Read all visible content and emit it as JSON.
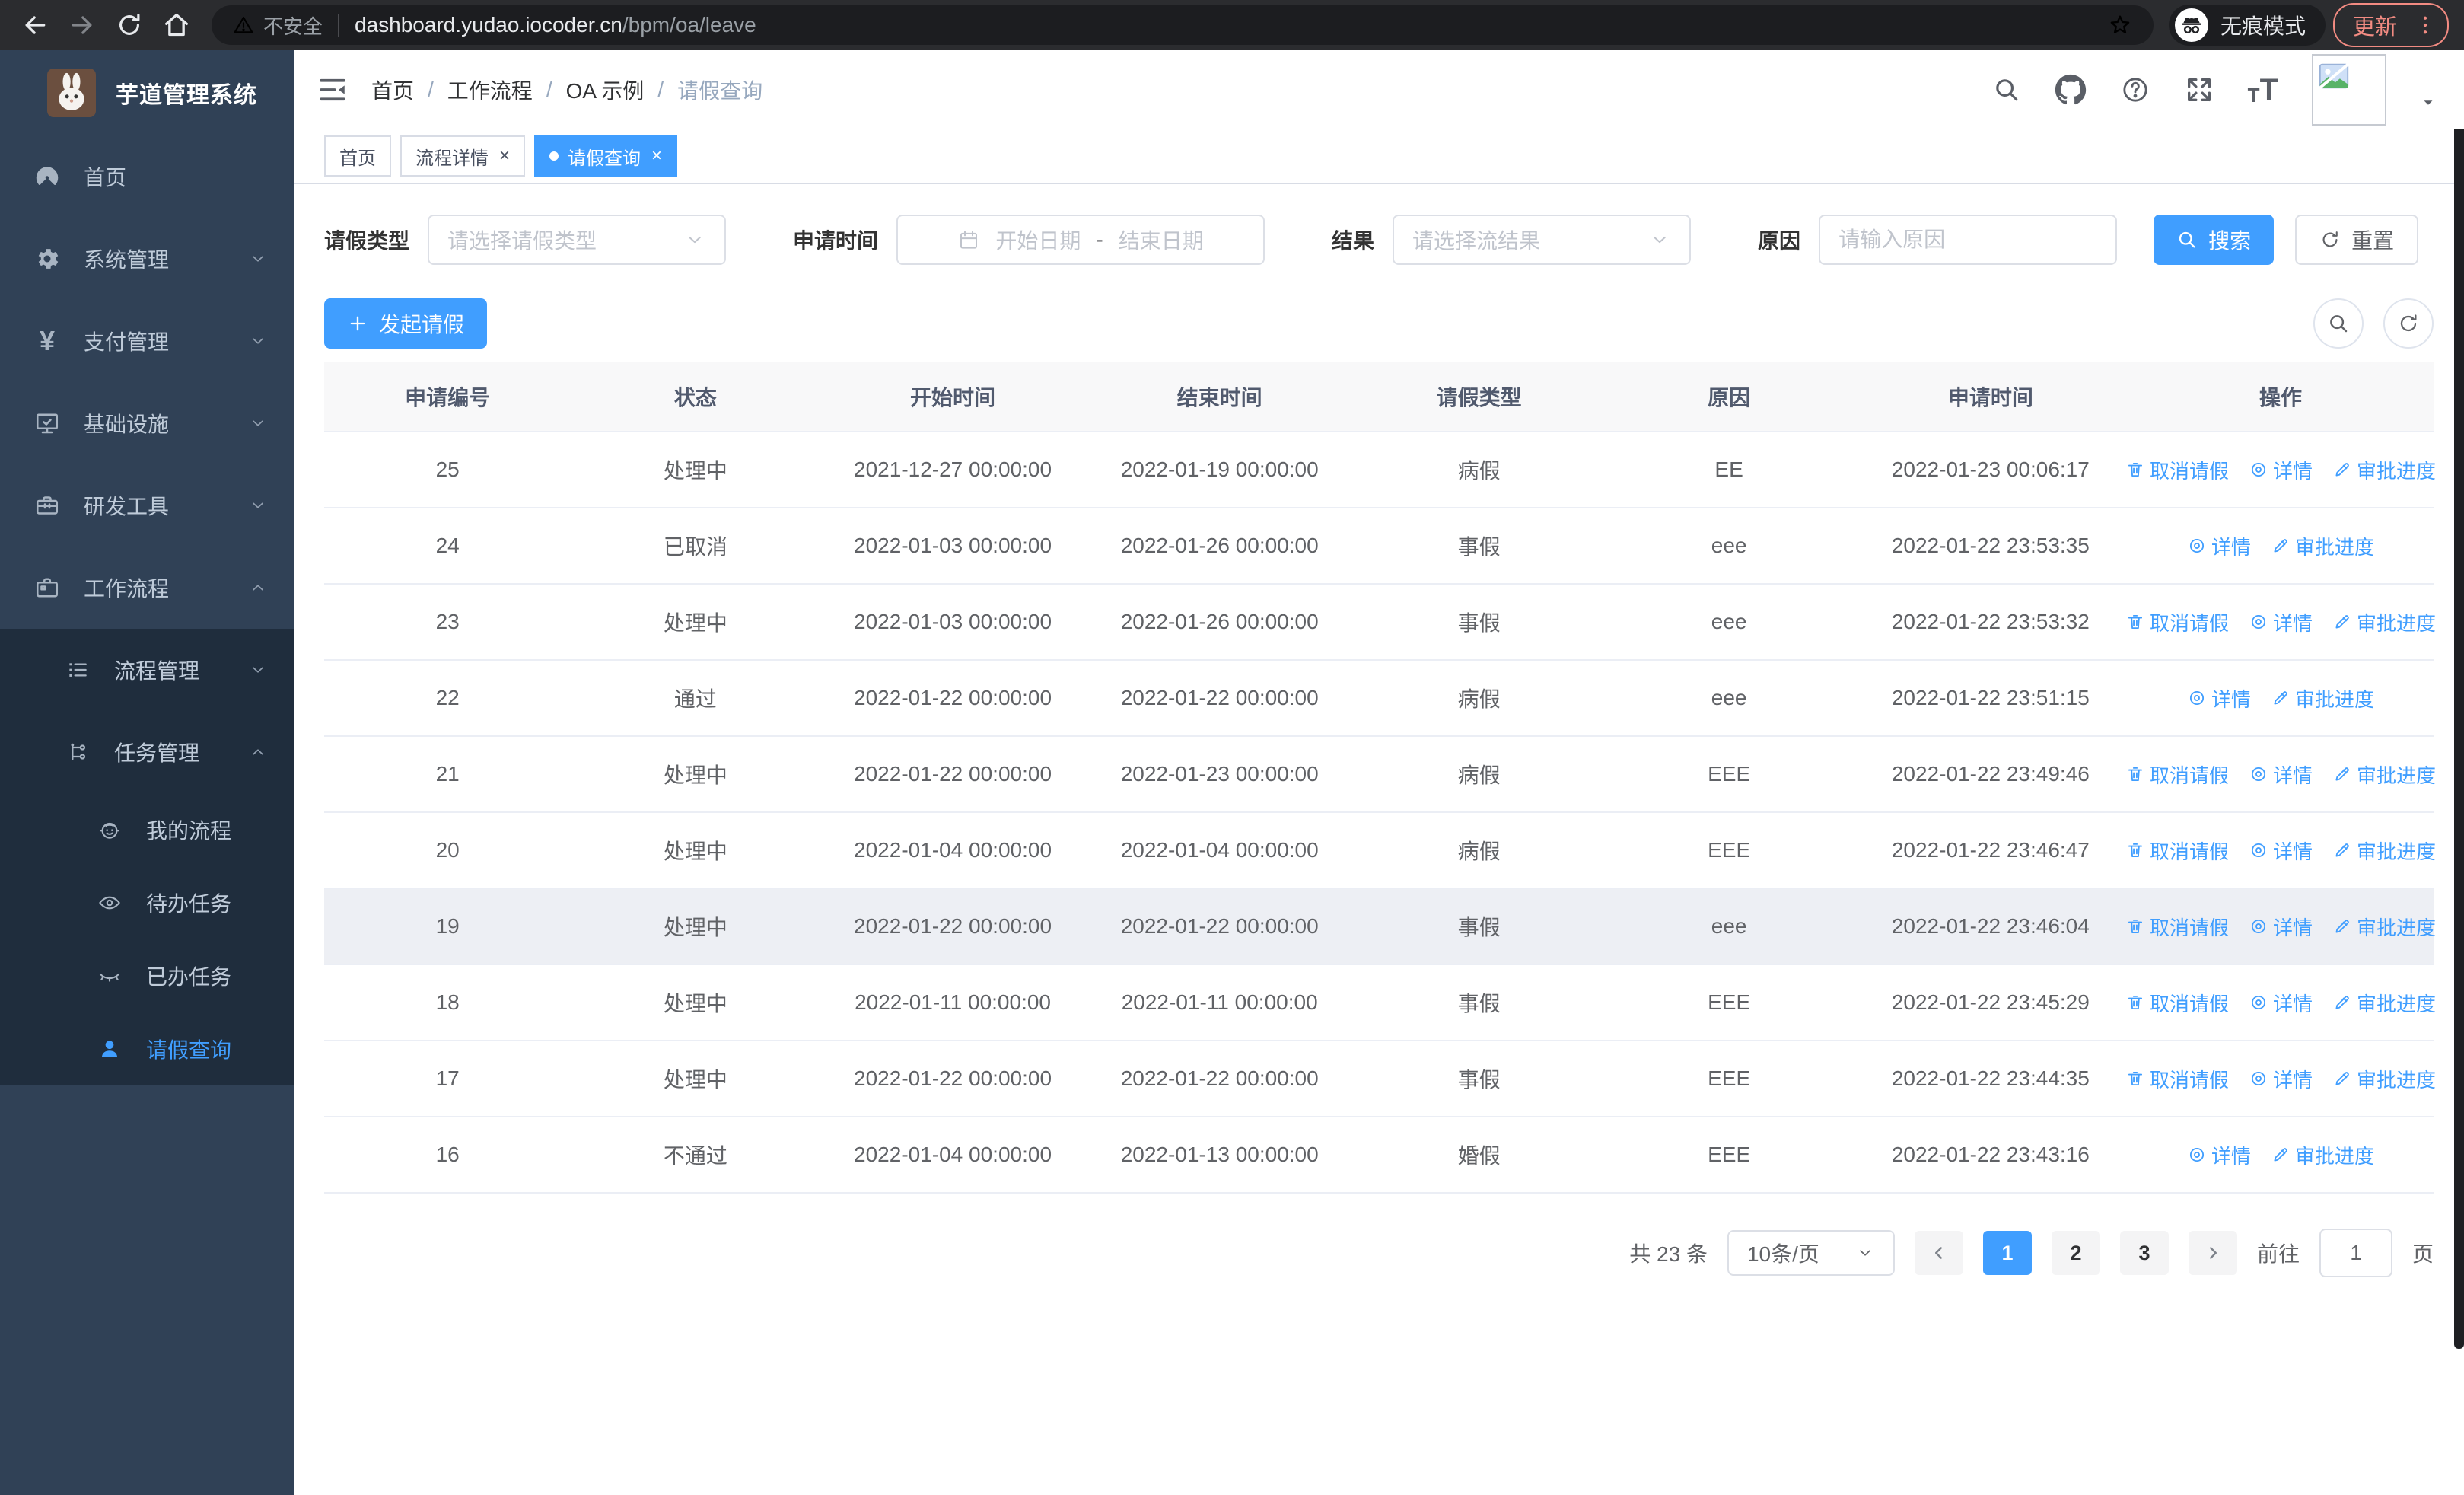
{
  "browser": {
    "security": "不安全",
    "url_host": "dashboard.yudao.iocoder.cn",
    "url_path": "/bpm/oa/leave",
    "incognito_label": "无痕模式",
    "update_label": "更新"
  },
  "sidebar": {
    "title": "芋道管理系统",
    "menu": [
      {
        "key": "home",
        "label": "首页",
        "icon": "dashboard-icon"
      },
      {
        "key": "system",
        "label": "系统管理",
        "icon": "gear-icon",
        "arrow": "down"
      },
      {
        "key": "payment",
        "label": "支付管理",
        "icon": "yen-icon",
        "arrow": "down"
      },
      {
        "key": "infrastructure",
        "label": "基础设施",
        "icon": "monitor-icon",
        "arrow": "down"
      },
      {
        "key": "dev-tools",
        "label": "研发工具",
        "icon": "toolbox-icon",
        "arrow": "down"
      },
      {
        "key": "workflow",
        "label": "工作流程",
        "icon": "briefcase-icon",
        "arrow": "up",
        "children": [
          {
            "key": "process-mgmt",
            "label": "流程管理",
            "icon": "list-tree-icon",
            "arrow": "down"
          },
          {
            "key": "task-mgmt",
            "label": "任务管理",
            "icon": "branch-icon",
            "arrow": "up",
            "children": [
              {
                "key": "my-process",
                "label": "我的流程",
                "icon": "robot-icon"
              },
              {
                "key": "todo-tasks",
                "label": "待办任务",
                "icon": "eye-open-icon"
              },
              {
                "key": "done-tasks",
                "label": "已办任务",
                "icon": "eye-closed-icon"
              },
              {
                "key": "leave-query",
                "label": "请假查询",
                "icon": "user-icon",
                "active": true
              }
            ]
          }
        ]
      }
    ]
  },
  "breadcrumb": {
    "items": [
      "首页",
      "工作流程",
      "OA 示例",
      "请假查询"
    ]
  },
  "tabs": {
    "items": [
      {
        "label": "首页"
      },
      {
        "label": "流程详情",
        "closable": true
      },
      {
        "label": "请假查询",
        "closable": true,
        "active": true
      }
    ]
  },
  "filters": {
    "leave_type_label": "请假类型",
    "leave_type_placeholder": "请选择请假类型",
    "apply_time_label": "申请时间",
    "start_date_placeholder": "开始日期",
    "date_separator": "-",
    "end_date_placeholder": "结束日期",
    "result_label": "结果",
    "result_placeholder": "请选择流结果",
    "reason_label": "原因",
    "reason_placeholder": "请输入原因",
    "search_label": "搜索",
    "reset_label": "重置"
  },
  "actions": {
    "create_label": "发起请假"
  },
  "table": {
    "columns": [
      "申请编号",
      "状态",
      "开始时间",
      "结束时间",
      "请假类型",
      "原因",
      "申请时间",
      "操作"
    ],
    "op_labels": {
      "cancel": "取消请假",
      "detail": "详情",
      "progress": "审批进度"
    },
    "rows": [
      {
        "id": "25",
        "status": "处理中",
        "start": "2021-12-27 00:00:00",
        "end": "2022-01-19 00:00:00",
        "type": "病假",
        "reason": "EE",
        "applied": "2022-01-23 00:06:17",
        "ops": [
          "cancel",
          "detail",
          "progress"
        ]
      },
      {
        "id": "24",
        "status": "已取消",
        "start": "2022-01-03 00:00:00",
        "end": "2022-01-26 00:00:00",
        "type": "事假",
        "reason": "eee",
        "applied": "2022-01-22 23:53:35",
        "ops": [
          "detail",
          "progress"
        ]
      },
      {
        "id": "23",
        "status": "处理中",
        "start": "2022-01-03 00:00:00",
        "end": "2022-01-26 00:00:00",
        "type": "事假",
        "reason": "eee",
        "applied": "2022-01-22 23:53:32",
        "ops": [
          "cancel",
          "detail",
          "progress"
        ]
      },
      {
        "id": "22",
        "status": "通过",
        "start": "2022-01-22 00:00:00",
        "end": "2022-01-22 00:00:00",
        "type": "病假",
        "reason": "eee",
        "applied": "2022-01-22 23:51:15",
        "ops": [
          "detail",
          "progress"
        ]
      },
      {
        "id": "21",
        "status": "处理中",
        "start": "2022-01-22 00:00:00",
        "end": "2022-01-23 00:00:00",
        "type": "病假",
        "reason": "EEE",
        "applied": "2022-01-22 23:49:46",
        "ops": [
          "cancel",
          "detail",
          "progress"
        ]
      },
      {
        "id": "20",
        "status": "处理中",
        "start": "2022-01-04 00:00:00",
        "end": "2022-01-04 00:00:00",
        "type": "病假",
        "reason": "EEE",
        "applied": "2022-01-22 23:46:47",
        "ops": [
          "cancel",
          "detail",
          "progress"
        ]
      },
      {
        "id": "19",
        "status": "处理中",
        "start": "2022-01-22 00:00:00",
        "end": "2022-01-22 00:00:00",
        "type": "事假",
        "reason": "eee",
        "applied": "2022-01-22 23:46:04",
        "ops": [
          "cancel",
          "detail",
          "progress"
        ],
        "hover": true
      },
      {
        "id": "18",
        "status": "处理中",
        "start": "2022-01-11 00:00:00",
        "end": "2022-01-11 00:00:00",
        "type": "事假",
        "reason": "EEE",
        "applied": "2022-01-22 23:45:29",
        "ops": [
          "cancel",
          "detail",
          "progress"
        ]
      },
      {
        "id": "17",
        "status": "处理中",
        "start": "2022-01-22 00:00:00",
        "end": "2022-01-22 00:00:00",
        "type": "事假",
        "reason": "EEE",
        "applied": "2022-01-22 23:44:35",
        "ops": [
          "cancel",
          "detail",
          "progress"
        ]
      },
      {
        "id": "16",
        "status": "不通过",
        "start": "2022-01-04 00:00:00",
        "end": "2022-01-13 00:00:00",
        "type": "婚假",
        "reason": "EEE",
        "applied": "2022-01-22 23:43:16",
        "ops": [
          "detail",
          "progress"
        ]
      }
    ]
  },
  "pagination": {
    "total": "共 23 条",
    "page_size": "10条/页",
    "pages": [
      "1",
      "2",
      "3"
    ],
    "active_page": "1",
    "goto_label": "前往",
    "goto_value": "1",
    "page_label": "页"
  },
  "colors": {
    "accent": "#409eff",
    "sidebar_bg": "#304156",
    "submenu_bg": "#1f2d3d",
    "update_red": "#f28b82"
  }
}
